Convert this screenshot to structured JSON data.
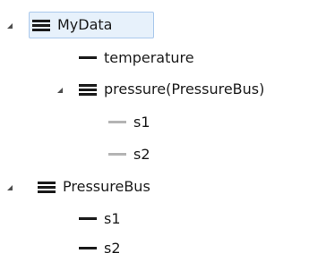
{
  "tree": {
    "nodes": [
      {
        "label": "MyData",
        "icon": "bus-icon",
        "expanded": true,
        "selected": true
      },
      {
        "label": "temperature",
        "icon": "signal-icon"
      },
      {
        "label": "pressure(PressureBus)",
        "icon": "bus-icon",
        "expanded": true
      },
      {
        "label": "s1",
        "icon": "signal-icon",
        "muted": true
      },
      {
        "label": "s2",
        "icon": "signal-icon",
        "muted": true
      },
      {
        "label": "PressureBus",
        "icon": "bus-icon",
        "expanded": true
      },
      {
        "label": "s1",
        "icon": "signal-icon"
      },
      {
        "label": "s2",
        "icon": "signal-icon"
      }
    ]
  },
  "colors": {
    "selection_border": "#a9c8ec",
    "selection_fill": "#e7f1fb",
    "icon_primary": "#1a1a1a",
    "icon_muted": "#b4b4b4",
    "expander": "#4d4d4d"
  }
}
